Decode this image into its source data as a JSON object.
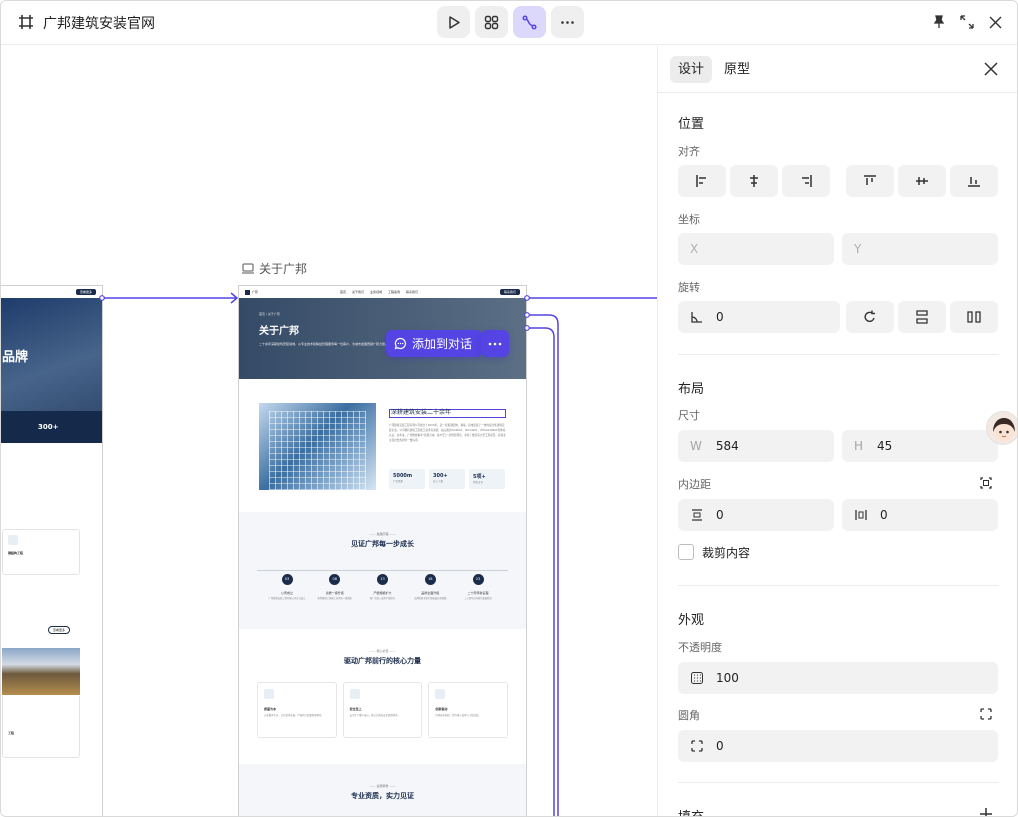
{
  "topbar": {
    "title": "广邦建筑安装官网",
    "buttons": [
      "play",
      "components",
      "connections",
      "more"
    ]
  },
  "canvas": {
    "page_label": "关于广邦",
    "add_to_chat": "添加到对话",
    "left_frame": {
      "hero_title": "品牌",
      "stat": "300+",
      "card_title": "钢结构工程",
      "card2_title": "工程",
      "btn": "查看更多"
    },
    "main_frame": {
      "nav_logo": "广邦",
      "nav_items": [
        "首页",
        "关于我们",
        "业务领域",
        "工程案例",
        "联系我们"
      ],
      "nav_button": "联系我们",
      "crumb": "首页 / 关于广邦",
      "hero_title": "关于广邦",
      "hero_sub": "二十余年深耕建筑安装领域，以专业技术和精益管理服务每一位客户，为城市发展贡献广邦力量。",
      "about_title": "深耕建筑安装二十余年",
      "about_text": "广邦建筑安装工程有限公司成立于2003年，是一家集钢结构、幕墙、机电安装于一体的综合性建筑安装企业。公司拥有建筑工程施工总承包资质，先后通过ISO9001、ISO14001、OHSAS18001等体系认证。多年来，广邦始终秉承“质量为本、客户至上”的经营理念，承接了数百项大型工程项目，获得业主及社会各界的一致好评。",
      "stats": [
        {
          "value": "5000m",
          "label": "厂房面积"
        },
        {
          "value": "300+",
          "label": "员工人数"
        },
        {
          "value": "5项+",
          "label": "资质证书"
        }
      ],
      "timeline_tag": "—— 发展历程 ——",
      "timeline_title": "见证广邦每一步成长",
      "timeline": [
        {
          "year": "03",
          "title": "公司成立",
          "desc": "广邦建筑安装工程有限公司正式成立"
        },
        {
          "year": "08",
          "title": "资质一级升级",
          "desc": "获得建筑工程施工总承包一级资质"
        },
        {
          "year": "13",
          "title": "产能规模扩大",
          "desc": "新厂房投入使用产能提升"
        },
        {
          "year": "18",
          "title": "品牌全面升级",
          "desc": "品牌形象全新升级拓展业务版图"
        },
        {
          "year": "23",
          "title": "二十周年新征程",
          "desc": "二十周年迈向新的发展阶段"
        }
      ],
      "values_tag": "—— 核心价值 ——",
      "values_title": "驱动广邦前行的核心力量",
      "values": [
        {
          "title": "质量为本",
          "desc": "以质量求生存，以信誉求发展，严格执行质量管理体系。"
        },
        {
          "title": "安全至上",
          "desc": "安全生产重于泰山，建立完善的安全管理体系。"
        },
        {
          "title": "创新驱动",
          "desc": "持续技术创新，提升施工效率与工程品质。"
        }
      ],
      "cert_tag": "—— 资质荣誉 ——",
      "cert_title": "专业资质，实力见证"
    }
  },
  "panel": {
    "tabs": [
      "设计",
      "原型"
    ],
    "active_tab": "设计",
    "position": {
      "title": "位置",
      "align_label": "对齐",
      "coord_label": "坐标",
      "x_placeholder": "X",
      "y_placeholder": "Y",
      "rotate_label": "旋转",
      "rotate_value": "0"
    },
    "layout": {
      "title": "布局",
      "size_label": "尺寸",
      "w_prefix": "W",
      "w_value": "584",
      "h_prefix": "H",
      "h_value": "45",
      "padding_label": "内边距",
      "padding_v": "0",
      "padding_h": "0",
      "clip_label": "裁剪内容"
    },
    "appearance": {
      "title": "外观",
      "opacity_label": "不透明度",
      "opacity_value": "100",
      "radius_label": "圆角",
      "radius_value": "0"
    },
    "fill": {
      "title": "填充"
    }
  },
  "colors": {
    "accent": "#5444e4",
    "accent_light": "#dcd8fb",
    "navy": "#1b2c4b"
  }
}
